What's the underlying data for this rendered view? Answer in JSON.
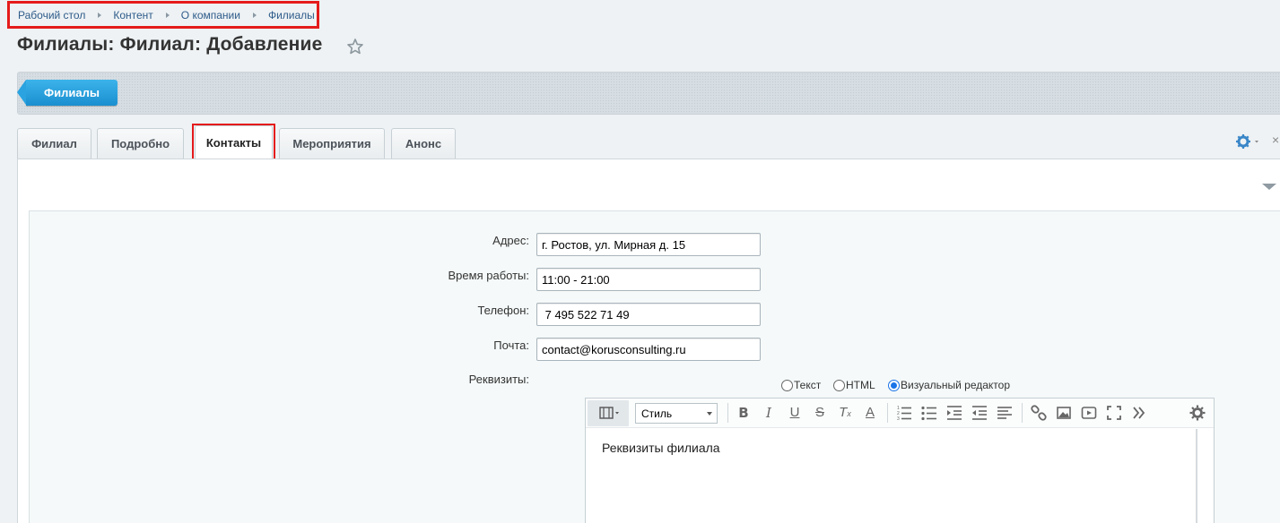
{
  "breadcrumb": [
    "Рабочий стол",
    "Контент",
    "О компании",
    "Филиалы"
  ],
  "page_title": "Филиалы: Филиал: Добавление",
  "toolbar": {
    "back_button_label": "Филиалы"
  },
  "tabs": [
    {
      "label": "Филиал",
      "active": false
    },
    {
      "label": "Подробно",
      "active": false
    },
    {
      "label": "Контакты",
      "active": true
    },
    {
      "label": "Мероприятия",
      "active": false
    },
    {
      "label": "Анонс",
      "active": false
    }
  ],
  "form": {
    "address": {
      "label": "Адрес:",
      "value": "г. Ростов, ул. Мирная д. 15"
    },
    "hours": {
      "label": "Время работы:",
      "value": "11:00 - 21:00"
    },
    "phone": {
      "label": "Телефон:",
      "value": " 7 495 522 71 49"
    },
    "email": {
      "label": "Почта:",
      "value": "contact@korusconsulting.ru"
    },
    "requisites": {
      "label": "Реквизиты:"
    }
  },
  "editor": {
    "mode_options": [
      "Текст",
      "HTML",
      "Визуальный редактор"
    ],
    "selected_mode": "Визуальный редактор",
    "style_select_value": "Стиль",
    "content": "Реквизиты филиала",
    "toolbar_icons": [
      "bold-icon",
      "italic-icon",
      "underline-icon",
      "strikethrough-icon",
      "clear-format-icon",
      "font-color-icon",
      "ordered-list-icon",
      "unordered-list-icon",
      "indent-icon",
      "outdent-icon",
      "align-icon",
      "link-icon",
      "image-icon",
      "video-icon",
      "fullscreen-icon",
      "more-icon",
      "settings-icon"
    ]
  },
  "colors": {
    "accent": "#1a8fd0",
    "highlight": "#e51b1b",
    "link": "#2e5b8a"
  }
}
